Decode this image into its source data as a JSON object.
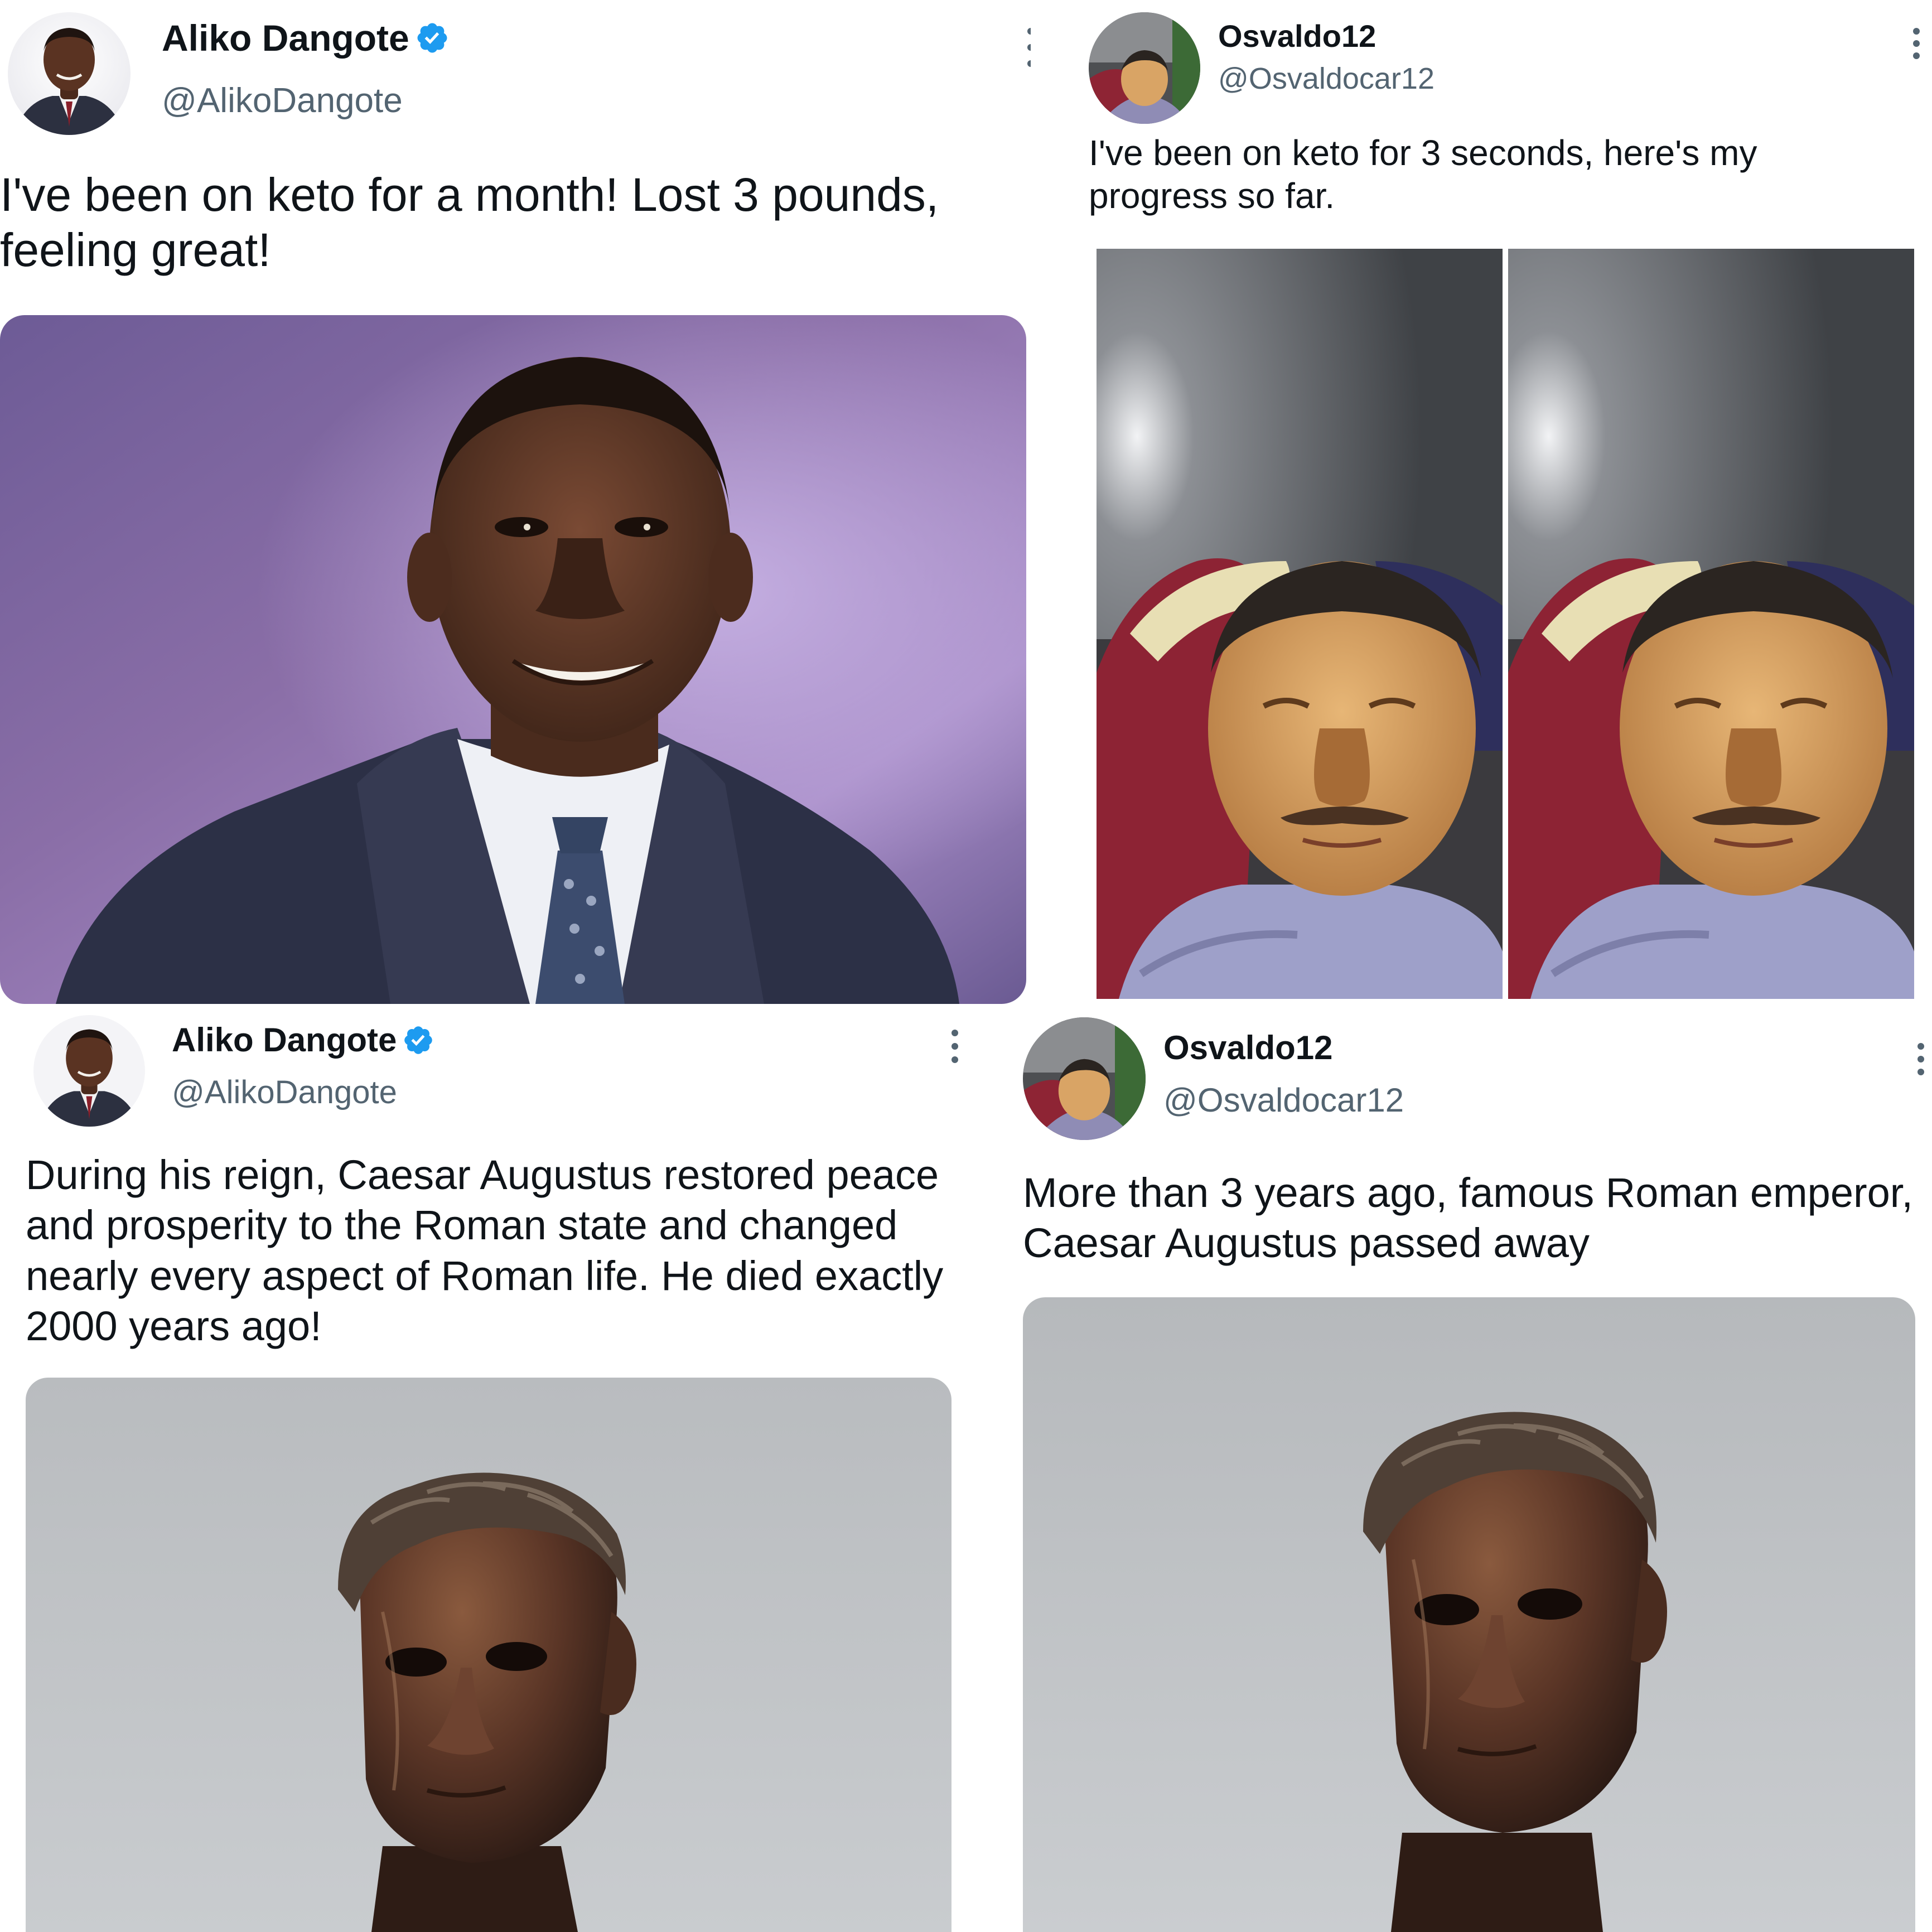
{
  "tweets": {
    "top_left": {
      "name": "Aliko Dangote",
      "handle": "@AlikoDangote",
      "text": "I've been on keto for a month! Lost 3 pounds, feeling great!",
      "media_icon": "person-photo-image",
      "avatar_icon": "profile-photo",
      "verified_icon": "verified-badge-icon",
      "more_icon": "more-options-icon"
    },
    "top_right": {
      "name": "Osvaldo12",
      "handle": "@Osvaldocar12",
      "text": "I've been on keto for 3 seconds, here's  my progress so far.",
      "media_icon": "selfie-photo-pair",
      "avatar_icon": "profile-photo",
      "more_icon": "more-options-icon"
    },
    "bottom_left": {
      "name": "Aliko Dangote",
      "handle": "@AlikoDangote",
      "text": "During his reign, Caesar Augustus restored peace and prosperity to the Roman state and changed nearly every aspect of Roman life. He died exactly 2000 years ago!",
      "media_icon": "bronze-bust-photo",
      "avatar_icon": "profile-photo",
      "verified_icon": "verified-badge-icon",
      "more_icon": "more-options-icon"
    },
    "bottom_right": {
      "name": "Osvaldo12",
      "handle": "@Osvaldocar12",
      "text": "More than 3 years ago, famous Roman emperor, Caesar Augustus passed away",
      "media_icon": "bronze-bust-photo",
      "avatar_icon": "profile-photo",
      "more_icon": "more-options-icon"
    }
  },
  "colors": {
    "name": "#0f1419",
    "handle": "#536471",
    "verified": "#1d9bf0",
    "background": "#ffffff"
  }
}
